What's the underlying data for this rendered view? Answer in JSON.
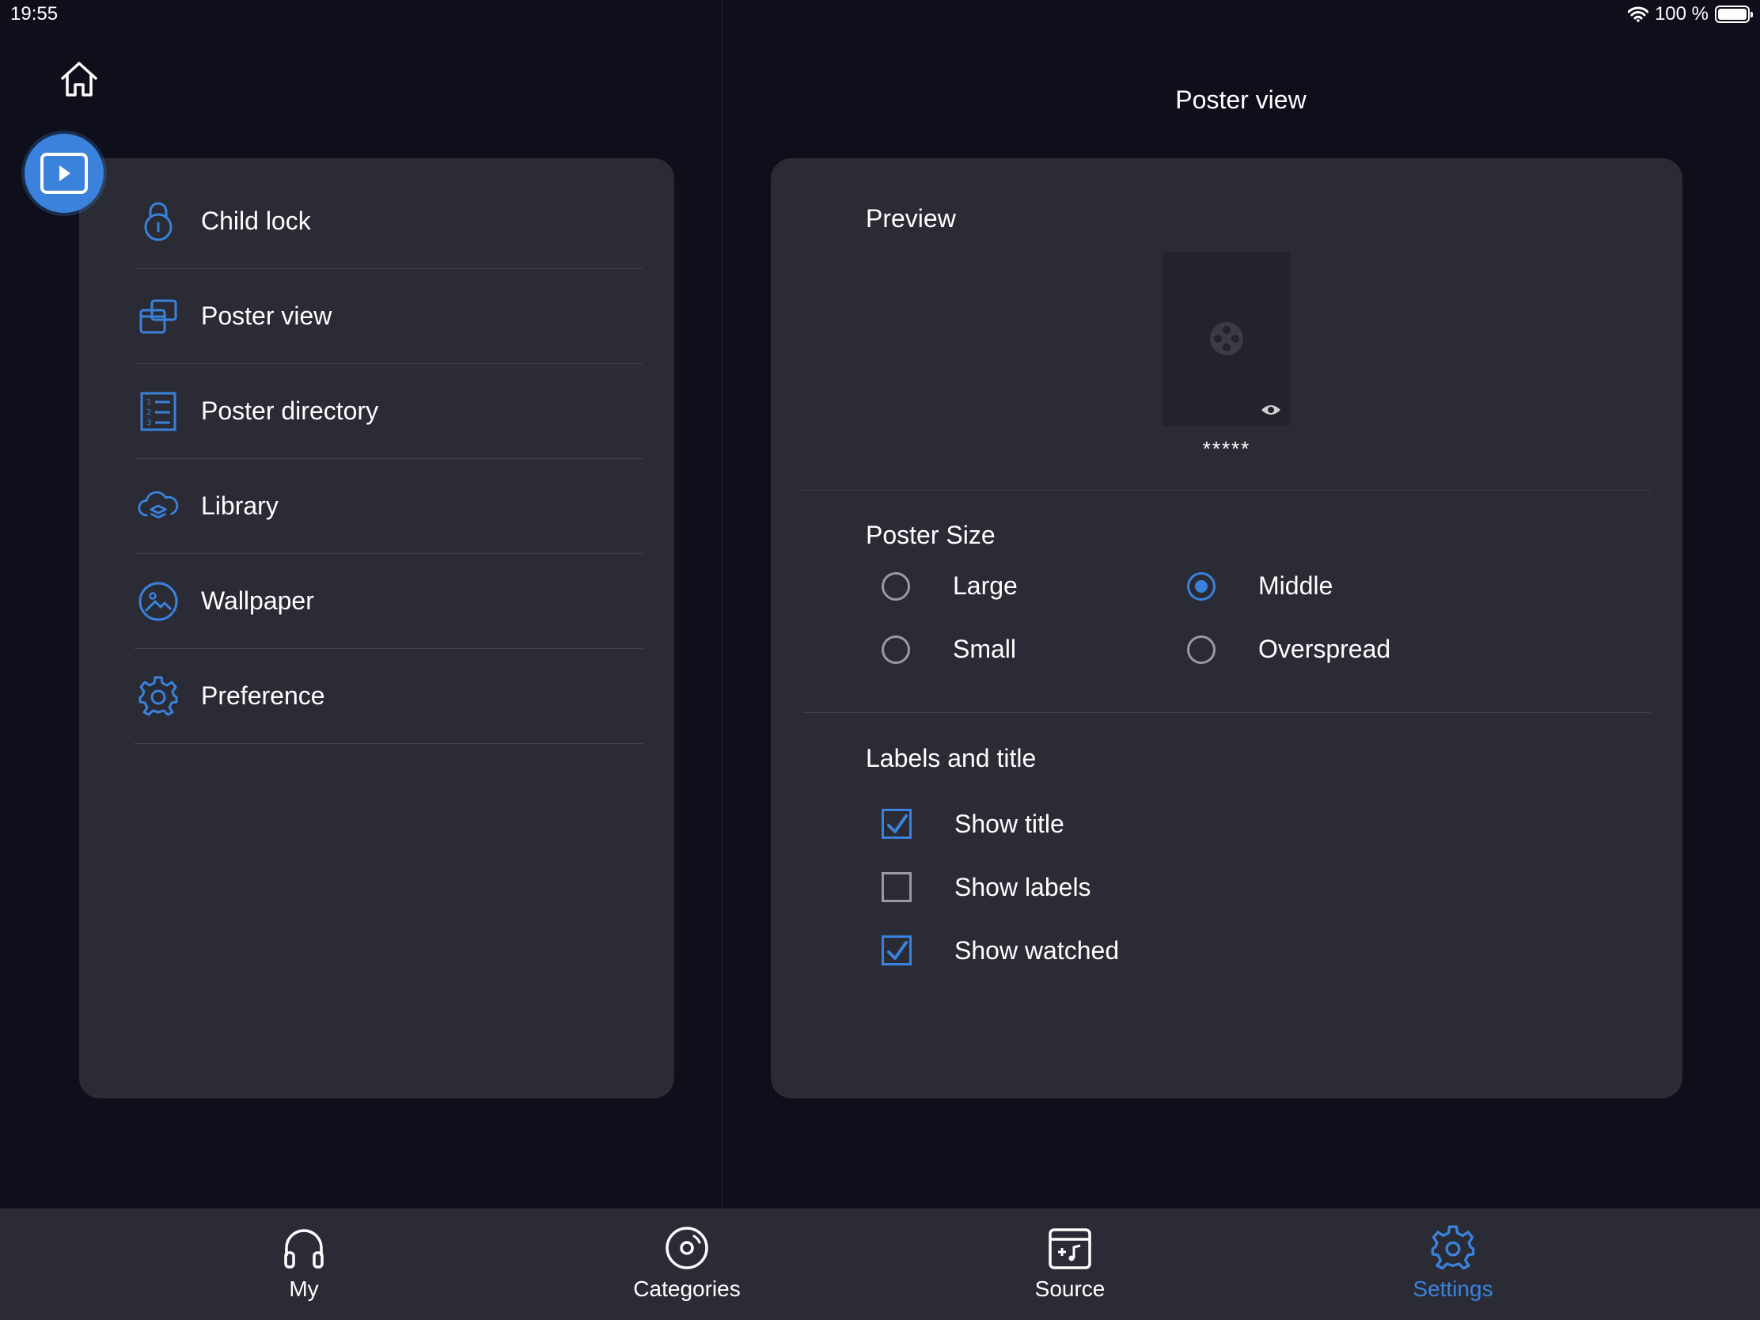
{
  "status_bar": {
    "time": "19:55",
    "battery": "100 %"
  },
  "left_menu": {
    "items": [
      {
        "label": "Child lock",
        "icon": "lock-icon"
      },
      {
        "label": "Poster view",
        "icon": "poster-view-icon"
      },
      {
        "label": "Poster directory",
        "icon": "list-numbered-icon"
      },
      {
        "label": "Library",
        "icon": "cloud-layers-icon"
      },
      {
        "label": "Wallpaper",
        "icon": "image-icon"
      },
      {
        "label": "Preference",
        "icon": "gear-icon"
      }
    ]
  },
  "right_panel": {
    "title": "Poster view",
    "preview": {
      "title": "Preview",
      "poster_caption": "*****"
    },
    "poster_size": {
      "title": "Poster Size",
      "options": [
        {
          "label": "Large",
          "selected": false
        },
        {
          "label": "Middle",
          "selected": true
        },
        {
          "label": "Small",
          "selected": false
        },
        {
          "label": "Overspread",
          "selected": false
        }
      ]
    },
    "labels_and_title": {
      "title": "Labels and title",
      "options": [
        {
          "label": "Show title",
          "checked": true
        },
        {
          "label": "Show labels",
          "checked": false
        },
        {
          "label": "Show watched",
          "checked": true
        }
      ]
    }
  },
  "tab_bar": {
    "tabs": [
      {
        "label": "My",
        "icon": "headphones-icon",
        "active": false
      },
      {
        "label": "Categories",
        "icon": "disc-icon",
        "active": false
      },
      {
        "label": "Source",
        "icon": "music-box-icon",
        "active": false
      },
      {
        "label": "Settings",
        "icon": "gear-icon",
        "active": true
      }
    ]
  },
  "colors": {
    "accent": "#3a82dc",
    "background": "#0f0f1c",
    "card": "#2a2b35",
    "divider": "#40414d"
  }
}
